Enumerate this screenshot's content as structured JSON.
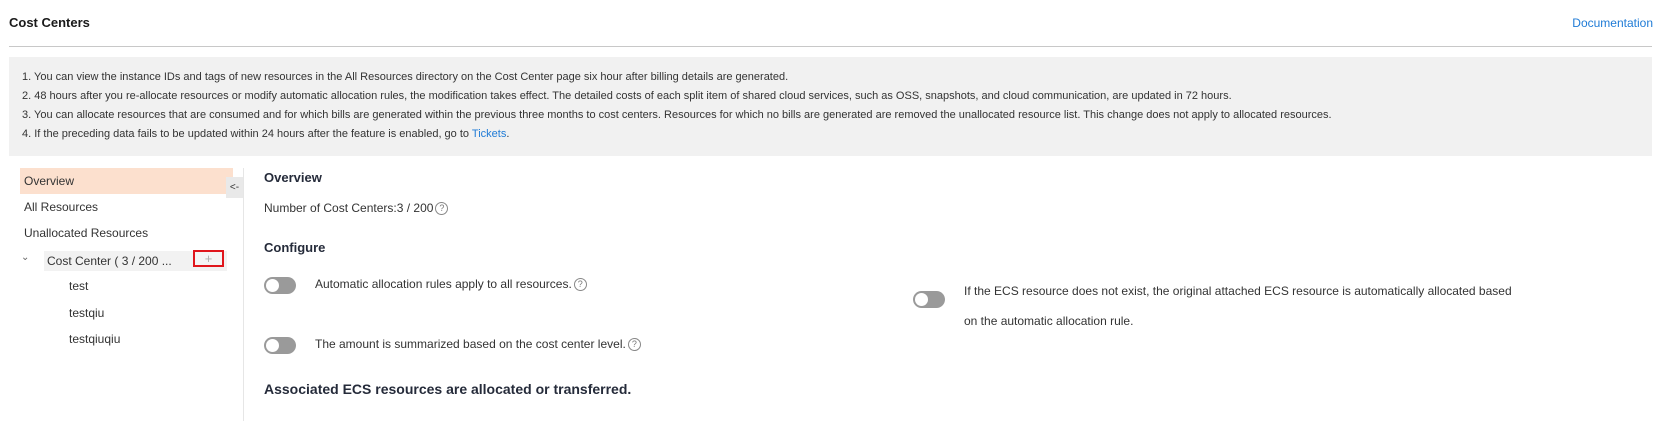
{
  "header": {
    "title": "Cost Centers",
    "documentation_link": "Documentation"
  },
  "notice": {
    "line1": "1. You can view the instance IDs and tags of new resources in the All Resources directory on the Cost Center page six hour after billing details are generated.",
    "line2": "2. 48 hours after you re-allocate resources or modify automatic allocation rules, the modification takes effect. The detailed costs of each split item of shared cloud services, such as OSS, snapshots, and cloud communication, are updated in 72 hours.",
    "line3": "3. You can allocate resources that are consumed and for which bills are generated within the previous three months to cost centers. Resources for which no bills are generated are removed the unallocated resource list. This change does not apply to allocated resources.",
    "line4_prefix": "4. If the preceding data fails to be updated within 24 hours after the feature is enabled, go to ",
    "line4_link": "Tickets",
    "line4_suffix": "."
  },
  "sidebar": {
    "collapse_label": "<-",
    "items": [
      {
        "label": "Overview"
      },
      {
        "label": "All Resources"
      },
      {
        "label": "Unallocated Resources"
      }
    ],
    "cost_center_group": {
      "caret": "⌄",
      "label": "Cost Center ( 3 / 200 ...",
      "add_label": "+",
      "children": [
        {
          "label": "test"
        },
        {
          "label": "testqiu"
        },
        {
          "label": "testqiuqiu"
        }
      ]
    }
  },
  "main": {
    "title": "Overview",
    "count_label": "Number of Cost Centers:3 / 200",
    "help_glyph": "?",
    "configure_title": "Configure",
    "toggle_auto_rules": {
      "label": "Automatic allocation rules apply to all resources.",
      "enabled": false
    },
    "toggle_summary": {
      "label": "The amount is summarized based on the cost center level.",
      "enabled": false
    },
    "toggle_ecs": {
      "label": "If the ECS resource does not exist, the original attached ECS resource is automatically allocated based on the automatic allocation rule.",
      "enabled": false
    },
    "associated_title": "Associated ECS resources are allocated or transferred."
  },
  "colors": {
    "accent_link": "#1f7bd6",
    "active_item_bg": "#fce0ce",
    "highlight_border": "#e0161c",
    "toggle_off": "#9a9a9a"
  }
}
